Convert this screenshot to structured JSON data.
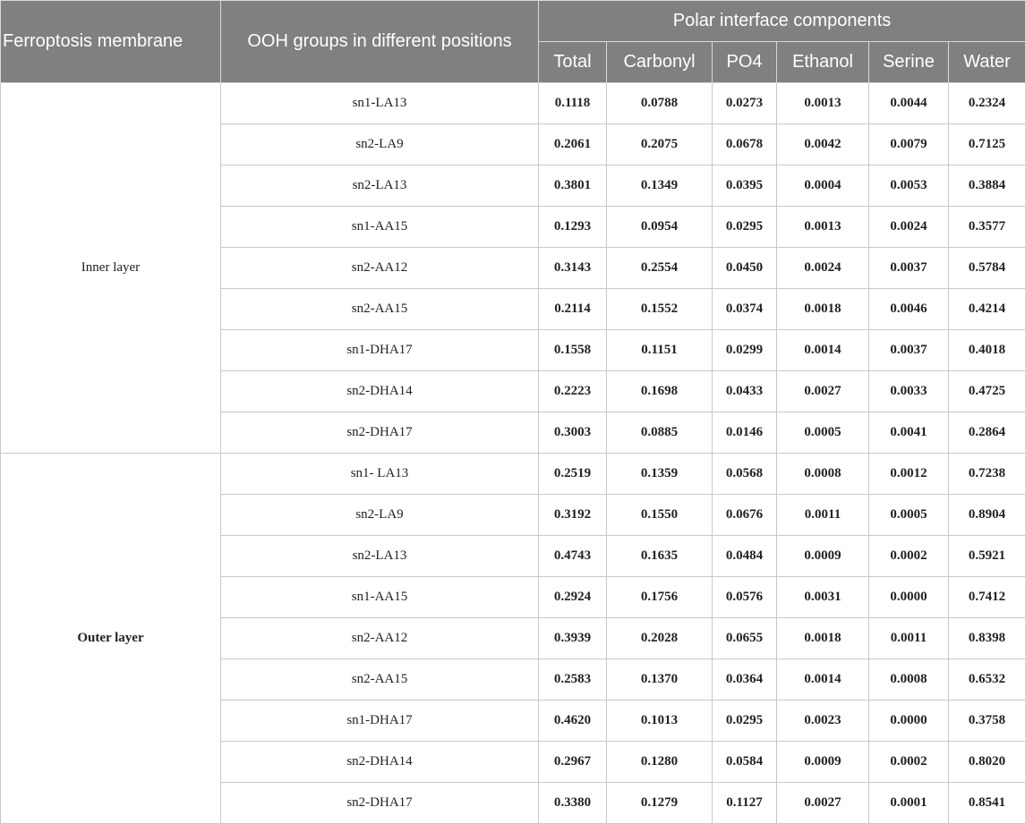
{
  "headers": {
    "membrane": "Ferroptosis membrane",
    "ooh": "OOH groups in different positions",
    "polar": "Polar interface components",
    "sub": [
      "Total",
      "Carbonyl",
      "PO4",
      "Ethanol",
      "Serine",
      "Water"
    ]
  },
  "groups": [
    {
      "label": "Inner layer",
      "bold": false,
      "rows": [
        {
          "pos": "sn1-LA13",
          "values": [
            "0.1118",
            "0.0788",
            "0.0273",
            "0.0013",
            "0.0044",
            "0.2324"
          ]
        },
        {
          "pos": "sn2-LA9",
          "values": [
            "0.2061",
            "0.2075",
            "0.0678",
            "0.0042",
            "0.0079",
            "0.7125"
          ]
        },
        {
          "pos": "sn2-LA13",
          "values": [
            "0.3801",
            "0.1349",
            "0.0395",
            "0.0004",
            "0.0053",
            "0.3884"
          ]
        },
        {
          "pos": "sn1-AA15",
          "values": [
            "0.1293",
            "0.0954",
            "0.0295",
            "0.0013",
            "0.0024",
            "0.3577"
          ]
        },
        {
          "pos": "sn2-AA12",
          "values": [
            "0.3143",
            "0.2554",
            "0.0450",
            "0.0024",
            "0.0037",
            "0.5784"
          ]
        },
        {
          "pos": "sn2-AA15",
          "values": [
            "0.2114",
            "0.1552",
            "0.0374",
            "0.0018",
            "0.0046",
            "0.4214"
          ]
        },
        {
          "pos": "sn1-DHA17",
          "values": [
            "0.1558",
            "0.1151",
            "0.0299",
            "0.0014",
            "0.0037",
            "0.4018"
          ]
        },
        {
          "pos": "sn2-DHA14",
          "values": [
            "0.2223",
            "0.1698",
            "0.0433",
            "0.0027",
            "0.0033",
            "0.4725"
          ]
        },
        {
          "pos": "sn2-DHA17",
          "values": [
            "0.3003",
            "0.0885",
            "0.0146",
            "0.0005",
            "0.0041",
            "0.2864"
          ]
        }
      ]
    },
    {
      "label": "Outer layer",
      "bold": true,
      "rows": [
        {
          "pos": "sn1- LA13",
          "values": [
            "0.2519",
            "0.1359",
            "0.0568",
            "0.0008",
            "0.0012",
            "0.7238"
          ]
        },
        {
          "pos": "sn2-LA9",
          "values": [
            "0.3192",
            "0.1550",
            "0.0676",
            "0.0011",
            "0.0005",
            "0.8904"
          ]
        },
        {
          "pos": "sn2-LA13",
          "values": [
            "0.4743",
            "0.1635",
            "0.0484",
            "0.0009",
            "0.0002",
            "0.5921"
          ]
        },
        {
          "pos": "sn1-AA15",
          "values": [
            "0.2924",
            "0.1756",
            "0.0576",
            "0.0031",
            "0.0000",
            "0.7412"
          ]
        },
        {
          "pos": "sn2-AA12",
          "values": [
            "0.3939",
            "0.2028",
            "0.0655",
            "0.0018",
            "0.0011",
            "0.8398"
          ]
        },
        {
          "pos": "sn2-AA15",
          "values": [
            "0.2583",
            "0.1370",
            "0.0364",
            "0.0014",
            "0.0008",
            "0.6532"
          ]
        },
        {
          "pos": "sn1-DHA17",
          "values": [
            "0.4620",
            "0.1013",
            "0.0295",
            "0.0023",
            "0.0000",
            "0.3758"
          ]
        },
        {
          "pos": "sn2-DHA14",
          "values": [
            "0.2967",
            "0.1280",
            "0.0584",
            "0.0009",
            "0.0002",
            "0.8020"
          ]
        },
        {
          "pos": "sn2-DHA17",
          "values": [
            "0.3380",
            "0.1279",
            "0.1127",
            "0.0027",
            "0.0001",
            "0.8541"
          ]
        }
      ]
    }
  ]
}
